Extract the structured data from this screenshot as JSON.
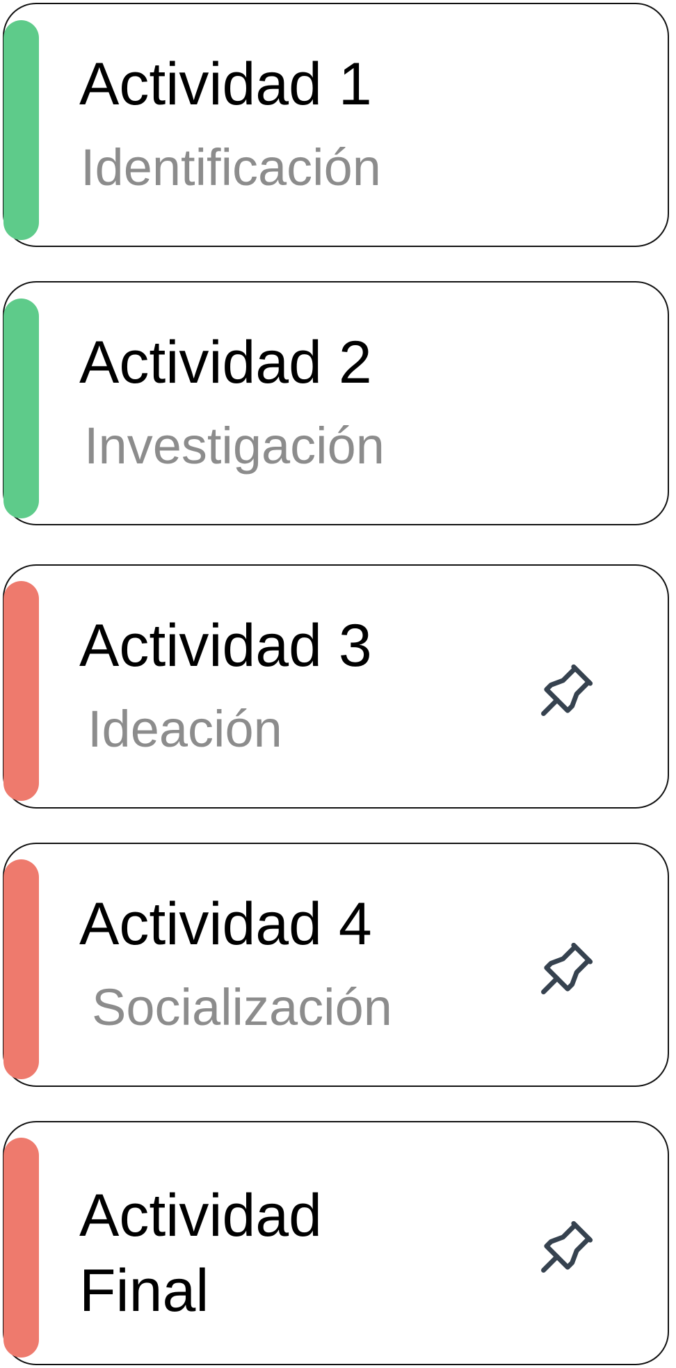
{
  "colors": {
    "completed": "#5ecb8a",
    "pending": "#ee7a6d",
    "card_border": "#111111",
    "subtitle_text": "#8c8c8c",
    "pin_icon": "#36424f"
  },
  "activities": [
    {
      "title": "Actividad 1",
      "subtitle": "Identificación",
      "status": "completed",
      "icon": null
    },
    {
      "title": "Actividad 2",
      "subtitle": "Investigación",
      "status": "completed",
      "icon": null
    },
    {
      "title": "Actividad 3",
      "subtitle": "Ideación",
      "status": "pending",
      "icon": "pin-icon"
    },
    {
      "title": "Actividad 4",
      "subtitle": "Socialización",
      "status": "pending",
      "icon": "pin-icon"
    },
    {
      "title_lines": [
        "Actividad",
        "Final"
      ],
      "subtitle": "",
      "status": "pending",
      "icon": "pin-icon"
    }
  ]
}
